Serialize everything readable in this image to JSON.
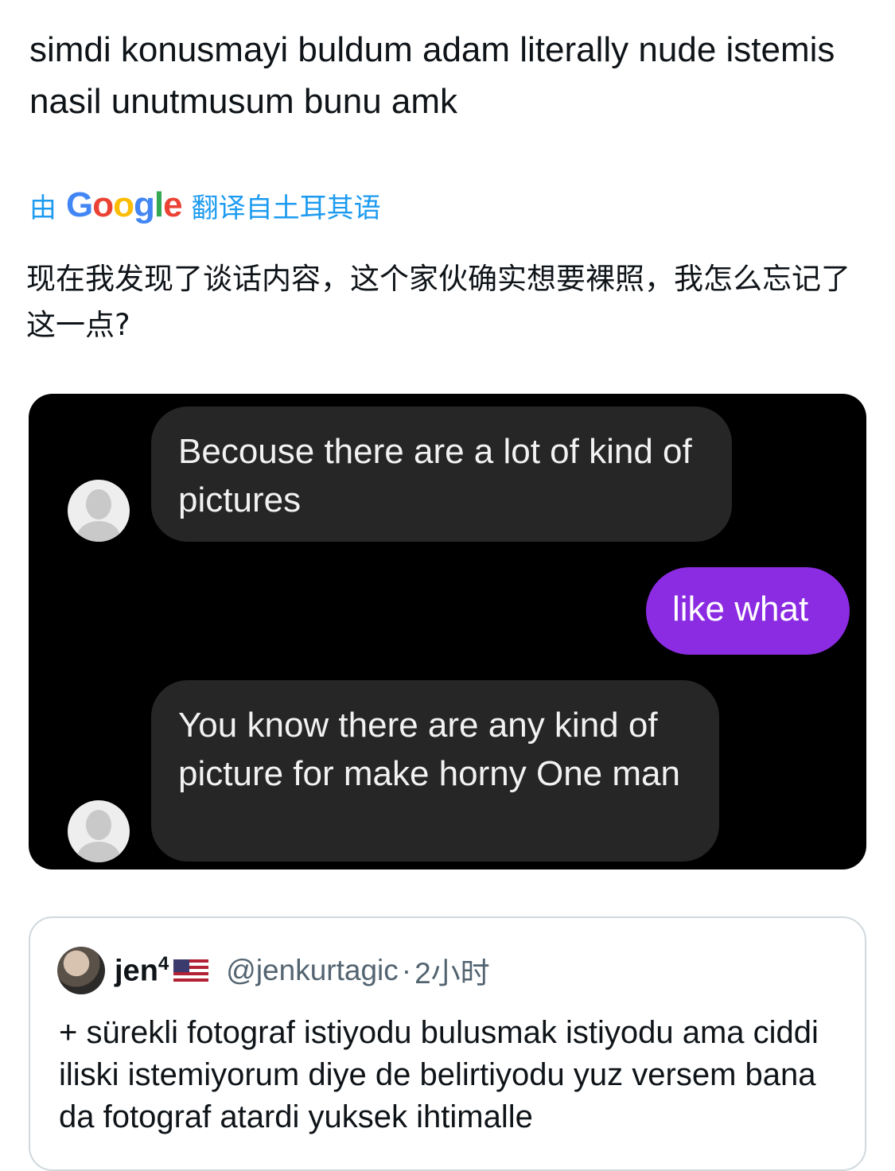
{
  "tweet": {
    "text": "simdi konusmayi buldum adam literally nude istemis nasil unutmusum bunu amk",
    "translate_prefix": "由",
    "translate_suffix": "翻译自土耳其语",
    "translated_text": "现在我发现了谈话内容，这个家伙确实想要裸照，我怎么忘记了这一点?"
  },
  "chat": {
    "messages": [
      {
        "direction": "incoming",
        "text": "Becouse there are a lot of kind of pictures"
      },
      {
        "direction": "outgoing",
        "text": "like what"
      },
      {
        "direction": "incoming",
        "text": "You know there are any kind of picture for make horny One man"
      }
    ]
  },
  "quote": {
    "name": "jen",
    "name_sup": "4",
    "handle": "@jenkurtagic",
    "separator": "·",
    "time": "2小时",
    "text": "+ sürekli fotograf istiyodu bulusmak istiyodu ama ciddi iliski istemiyorum diye de belirtiyodu yuz versem bana da fotograf atardi yuksek ihtimalle"
  },
  "icons": [
    "google-logo",
    "default-avatar-icon",
    "us-flag-icon"
  ]
}
